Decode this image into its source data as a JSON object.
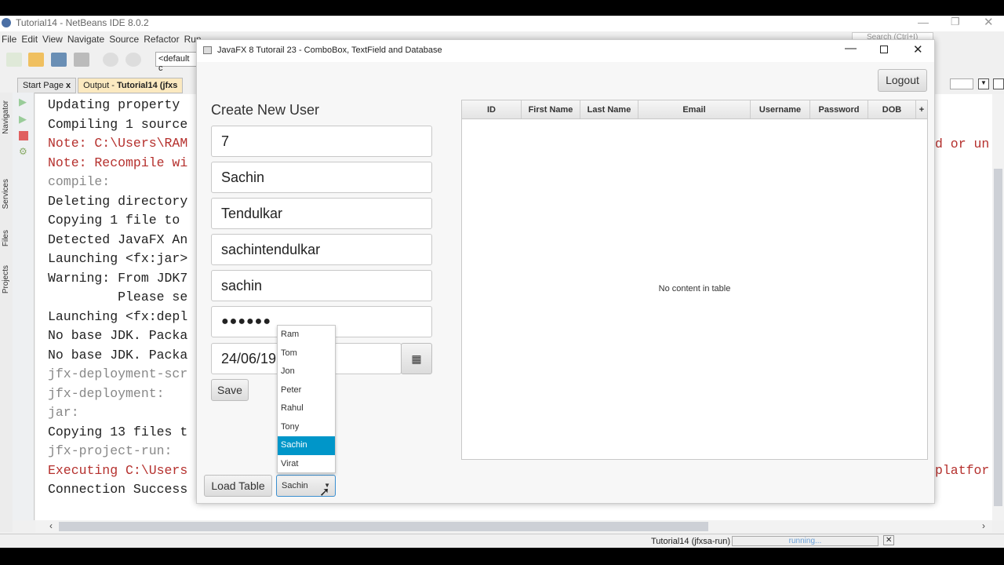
{
  "ide": {
    "title": "Tutorial14 - NetBeans IDE 8.0.2",
    "menu": [
      "File",
      "Edit",
      "View",
      "Navigate",
      "Source",
      "Refactor",
      "Run"
    ],
    "config_select": "<default c",
    "search_placeholder": "Search (Ctrl+I)",
    "tabs": [
      {
        "label": "Start Page",
        "close": "x"
      },
      {
        "label_prefix": "Output - ",
        "label_bold": "Tutorial14 (jfxs"
      }
    ],
    "side_panels": [
      "Navigator",
      "Services",
      "Files",
      "Projects"
    ],
    "output_lines": [
      {
        "text": "Updating property",
        "type": "normal"
      },
      {
        "text": "Compiling 1 source",
        "type": "normal"
      },
      {
        "text": "Note: C:\\Users\\RAM",
        "type": "red"
      },
      {
        "text": "Note: Recompile wi",
        "type": "red"
      },
      {
        "text": "compile:",
        "type": "gray"
      },
      {
        "text": "Deleting directory",
        "type": "normal"
      },
      {
        "text": "Copying 1 file to",
        "type": "normal"
      },
      {
        "text": "Detected JavaFX An",
        "type": "normal"
      },
      {
        "text": "Launching <fx:jar>",
        "type": "normal"
      },
      {
        "text": "Warning: From JDK7",
        "type": "normal"
      },
      {
        "text": "         Please se",
        "type": "normal"
      },
      {
        "text": "Launching <fx:depl",
        "type": "normal"
      },
      {
        "text": "No base JDK. Packa",
        "type": "normal"
      },
      {
        "text": "No base JDK. Packa",
        "type": "normal"
      },
      {
        "text": "jfx-deployment-scr",
        "type": "gray"
      },
      {
        "text": "jfx-deployment:",
        "type": "gray"
      },
      {
        "text": "jar:",
        "type": "gray"
      },
      {
        "text": "Copying 13 files t",
        "type": "normal"
      },
      {
        "text": "jfx-project-run:",
        "type": "gray"
      },
      {
        "text": "Executing C:\\Users",
        "type": "red"
      },
      {
        "text": "Connection Success",
        "type": "normal"
      }
    ],
    "right_fragments": [
      "d or un",
      "platfor"
    ],
    "status": {
      "task": "Tutorial14 (jfxsa-run)",
      "progress_text": "running..."
    }
  },
  "fx": {
    "title": "JavaFX 8 Tutorail 23 - ComboBox, TextField and Database",
    "logout": "Logout",
    "heading": "Create New User",
    "fields": {
      "id": "7",
      "first_name": "Sachin",
      "last_name": "Tendulkar",
      "email": "sachintendulkar",
      "username": "sachin",
      "password": "●●●●●●",
      "dob": "24/06/19"
    },
    "save": "Save",
    "load_table": "Load Table",
    "combo": {
      "selected": "Sachin",
      "options": [
        "Ram",
        "Tom",
        "Jon",
        "Peter",
        "Rahul",
        "Tony",
        "Sachin",
        "Virat"
      ]
    },
    "table": {
      "columns": [
        "ID",
        "First Name",
        "Last Name",
        "Email",
        "Username",
        "Password",
        "DOB"
      ],
      "add": "+",
      "empty": "No content in table"
    }
  }
}
